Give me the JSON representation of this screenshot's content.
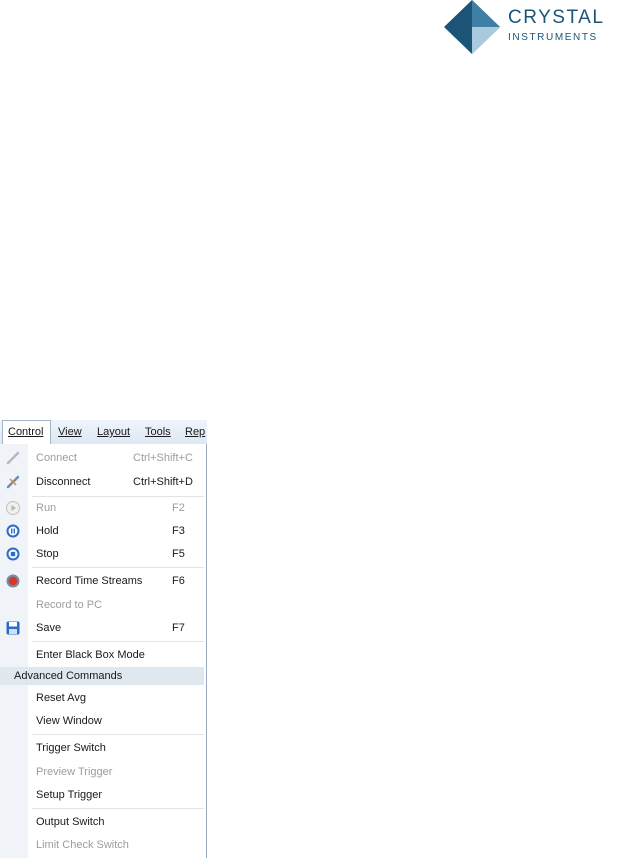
{
  "logo": {
    "line1": "CRYSTAL",
    "line2": "INSTRUMENTS",
    "colors": {
      "dark": "#1c5477",
      "mid": "#3f7fa6",
      "light": "#a9c9de"
    }
  },
  "menubar": {
    "items": [
      {
        "label": "Control",
        "active": true
      },
      {
        "label": "View"
      },
      {
        "label": "Layout"
      },
      {
        "label": "Tools"
      },
      {
        "label": "Rep"
      }
    ]
  },
  "menu": {
    "connect": {
      "label": "Connect",
      "shortcut": "Ctrl+Shift+C",
      "enabled": false,
      "icon": "connect-plug-icon"
    },
    "disconnect": {
      "label": "Disconnect",
      "shortcut": "Ctrl+Shift+D",
      "enabled": true,
      "icon": "disconnect-icon"
    },
    "run": {
      "label": "Run",
      "shortcut": "F2",
      "enabled": false,
      "icon": "play-icon"
    },
    "hold": {
      "label": "Hold",
      "shortcut": "F3",
      "enabled": true,
      "icon": "pause-icon"
    },
    "stop": {
      "label": "Stop",
      "shortcut": "F5",
      "enabled": true,
      "icon": "stop-icon"
    },
    "record_ts": {
      "label": "Record Time Streams",
      "shortcut": "F6",
      "enabled": true,
      "icon": "record-icon"
    },
    "record_pc": {
      "label": "Record to PC",
      "enabled": false
    },
    "save": {
      "label": "Save",
      "shortcut": "F7",
      "enabled": true,
      "icon": "floppy-disk-icon"
    },
    "black_box": {
      "label": "Enter Black Box Mode",
      "enabled": true
    },
    "advanced_header": "Advanced Commands",
    "reset_avg": {
      "label": "Reset Avg",
      "enabled": true
    },
    "view_window": {
      "label": "View Window",
      "enabled": true
    },
    "trigger_switch": {
      "label": "Trigger Switch",
      "enabled": true
    },
    "preview_trigger": {
      "label": "Preview Trigger",
      "enabled": false
    },
    "setup_trigger": {
      "label": "Setup Trigger",
      "enabled": true
    },
    "output_switch": {
      "label": "Output Switch",
      "enabled": true
    },
    "limit_check": {
      "label": "Limit Check Switch",
      "enabled": false
    }
  },
  "colors": {
    "menubar_bg": "#dde8f4",
    "icon_blue": "#2a6cc6",
    "record_red": "#d43a2a",
    "disabled_text": "#9d9d9d"
  }
}
